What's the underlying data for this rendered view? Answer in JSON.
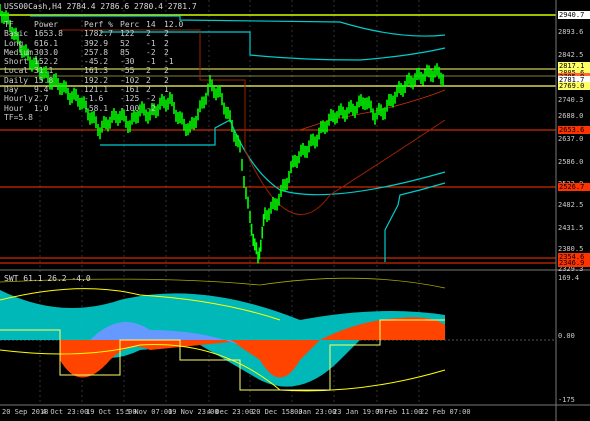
{
  "header": {
    "title": "USS00Cash,H4",
    "ohlc": "2784.4 2786.6 2780.4 2781.7"
  },
  "table": {
    "columns": [
      "TF",
      "Power",
      "Perf %",
      "Perc",
      "14",
      "12.0"
    ],
    "rows": [
      [
        "Basic",
        "1653.8",
        "1782.7",
        "122",
        "2",
        "2"
      ],
      [
        "Long",
        "616.1",
        "392.9",
        "52",
        "-1",
        "2"
      ],
      [
        "Medium",
        "303.0",
        "257.8",
        "85",
        "-2",
        "2"
      ],
      [
        "Short",
        "152.2",
        "-45.2",
        "-30",
        "-1",
        "-1"
      ],
      [
        "Local",
        "31.1",
        "161.3",
        "-55",
        "2",
        "2"
      ],
      [
        "Daily",
        "15.8",
        "192.2",
        "-102",
        "2",
        "2"
      ],
      [
        "Day",
        "9.4",
        "121.1",
        "-161",
        "2",
        "1"
      ],
      [
        "Hourly",
        "2.7",
        "-1.6",
        "-125",
        "-2",
        ""
      ],
      [
        "Hour",
        "1.0",
        "-58.1",
        "-100",
        "-2",
        ""
      ],
      [
        "TF=5.8",
        "",
        "",
        "",
        "",
        ""
      ]
    ]
  },
  "price_axis": [
    "2893.6",
    "2842.5",
    "2791.4",
    "2740.3",
    "2688.0",
    "2637.0",
    "2586.0",
    "2533.9",
    "2482.5",
    "2431.5",
    "2380.5",
    "2329.3"
  ],
  "price_tags": [
    {
      "text": "2940.7",
      "bg": "#ffffff",
      "fg": "#000000"
    },
    {
      "text": "2817.1",
      "bg": "#ffff66",
      "fg": "#000000"
    },
    {
      "text": "2805.6",
      "bg": "#ffff66",
      "fg": "#000000"
    },
    {
      "text": "2785.9",
      "bg": "#ff6633",
      "fg": "#000000"
    },
    {
      "text": "2781.7",
      "bg": "#ffffff",
      "fg": "#000000"
    },
    {
      "text": "2769.0",
      "bg": "#ffff66",
      "fg": "#000000"
    },
    {
      "text": "2653.6",
      "bg": "#ff3300",
      "fg": "#000000"
    },
    {
      "text": "2526.7",
      "bg": "#ff3300",
      "fg": "#000000"
    },
    {
      "text": "2354.6",
      "bg": "#ff3300",
      "fg": "#000000"
    },
    {
      "text": "2346.9",
      "bg": "#ff3300",
      "fg": "#000000"
    }
  ],
  "indicator": {
    "title": "SWT 61.1 26.2 -4.0",
    "axis": [
      "169.4",
      "0.00",
      "-175"
    ]
  },
  "time_axis": [
    "20 Sep 2018",
    "4 Oct 23:00",
    "19 Oct 15:00",
    "5 Nov 07:00",
    "19 Nov 23:00",
    "4 Dec 23:00",
    "20 Dec 15:00",
    "8 Jan 23:00",
    "23 Jan 19:00",
    "7 Feb 11:00",
    "22 Feb 07:00"
  ],
  "colors": {
    "bull": "#00ff00",
    "grid": "#555555",
    "cyan": "#00cccc",
    "red": "#cc3300",
    "yellow": "#ffff00"
  }
}
